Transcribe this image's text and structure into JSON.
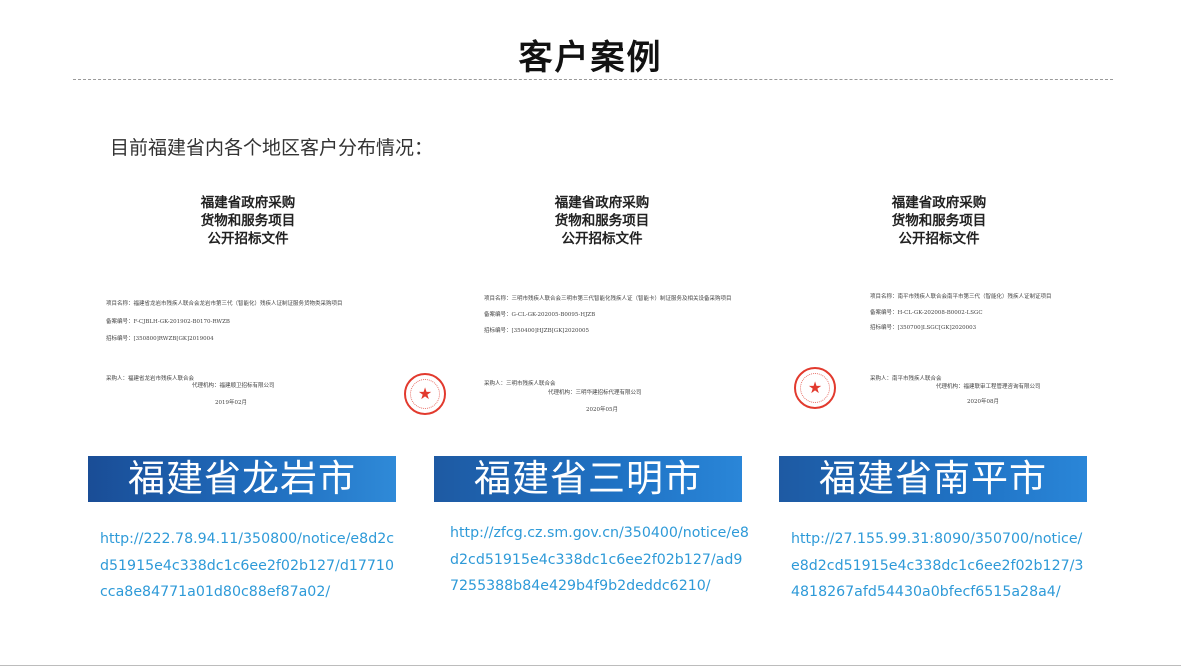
{
  "page": {
    "title": "客户案例",
    "intro": "目前福建省内各个地区客户分布情况："
  },
  "cases": [
    {
      "doc": {
        "heading_lines": [
          "福建省政府采购",
          "货物和服务项目",
          "公开招标文件"
        ],
        "project": "项目名称：福建省龙岩市残疾人联合会龙岩市第三代（智能化）残疾人证制证服务货物类采购项目",
        "record_no": "备案编号：F-CJBLH-GK-201902-B0170-RWZB",
        "bid_no": "招标编号：[350800]RWZB[GK]2019004",
        "purchaser": "采购人：福建省龙岩市残疾人联合会",
        "agency": "代理机构：福建顺卫招标有限公司",
        "date": "2019年02月"
      },
      "banner": "福建省龙岩市",
      "link": "http://222.78.94.11/350800/notice/e8d2cd51915e4c338dc1c6ee2f02b127/d17710cca8e84771a01d80c88ef87a02/"
    },
    {
      "doc": {
        "heading_lines": [
          "福建省政府采购",
          "货物和服务项目",
          "公开招标文件"
        ],
        "project": "项目名称：三明市残疾人联合会三明市第三代智能化残疾人证（智能卡）制证服务及相关设备采购项目",
        "record_no": "备案编号：G-CL-GK-202005-B0095-HJZB",
        "bid_no": "招标编号：[350400]HJZB[GK]2020005",
        "purchaser": "采购人：三明市残疾人联合会",
        "agency": "代理机构：三明华建招标代理有限公司",
        "date": "2020年05月"
      },
      "banner": "福建省三明市",
      "link": "http://zfcg.cz.sm.gov.cn/350400/notice/e8d2cd51915e4c338dc1c6ee2f02b127/ad97255388b84e429b4f9b2deddc6210/"
    },
    {
      "doc": {
        "heading_lines": [
          "福建省政府采购",
          "货物和服务项目",
          "公开招标文件"
        ],
        "project": "项目名称：南平市残疾人联合会南平市第三代（智能化）残疾人证制证项目",
        "record_no": "备案编号：H-CL-GK-202008-B0002-LSGC",
        "bid_no": "招标编号：[350700]LSGC[GK]2020003",
        "purchaser": "采购人：南平市残疾人联合会",
        "agency": "代理机构：福建联审工程管理咨询有限公司",
        "date": "2020年08月"
      },
      "banner": "福建省南平市",
      "link": "http://27.155.99.31:8090/350700/notice/e8d2cd51915e4c338dc1c6ee2f02b127/34818267afd54430a0bfecf6515a28a4/"
    }
  ],
  "colors": {
    "banner_blue": "#1f6cbd",
    "link_blue": "#2e9ad8",
    "stamp_red": "#e23a2e"
  },
  "icons": {
    "stamp": "red-star-seal-icon"
  }
}
